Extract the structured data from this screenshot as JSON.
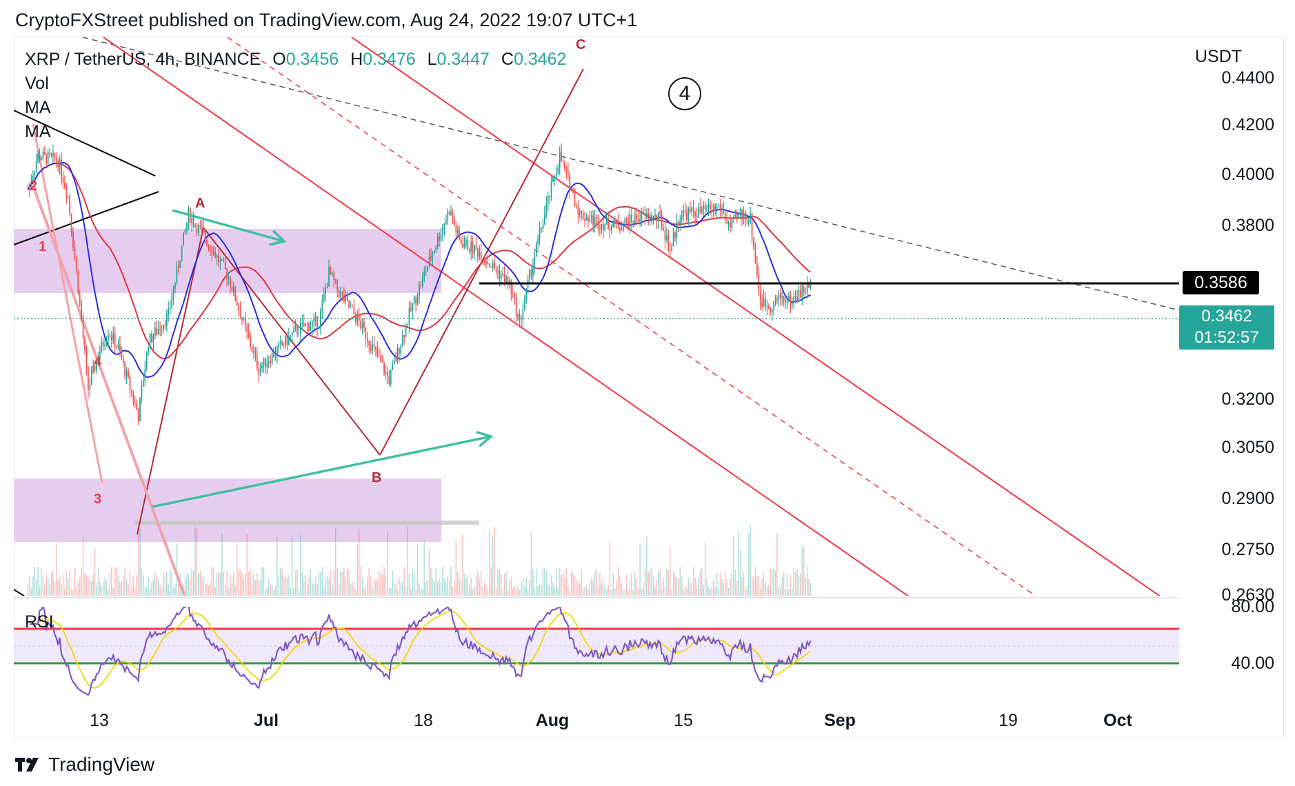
{
  "header": {
    "published": "CryptoFXStreet published on TradingView.com, Aug 24, 2022 19:07 UTC+1"
  },
  "legend": {
    "symbol": "XRP / TetherUS, 4h, BINANCE",
    "o_label": "O",
    "o_value": "0.3456",
    "h_label": "H",
    "h_value": "0.3476",
    "l_label": "L",
    "l_value": "0.3447",
    "c_label": "C",
    "c_value": "0.3462",
    "indicators": [
      "Vol",
      "MA",
      "MA"
    ]
  },
  "axis": {
    "unit": "USDT",
    "price_ticks": [
      "0.4400",
      "0.4200",
      "0.4000",
      "0.3800",
      "0.3200",
      "0.3050",
      "0.2900",
      "0.2750",
      "0.2630"
    ],
    "rsi_ticks": [
      "80.00",
      "40.00"
    ],
    "date_ticks": [
      {
        "label": "13",
        "bold": false
      },
      {
        "label": "Jul",
        "bold": true
      },
      {
        "label": "18",
        "bold": false
      },
      {
        "label": "Aug",
        "bold": true
      },
      {
        "label": "15",
        "bold": false
      },
      {
        "label": "Sep",
        "bold": true
      },
      {
        "label": "19",
        "bold": false
      },
      {
        "label": "Oct",
        "bold": true
      }
    ]
  },
  "price_tags": {
    "level": "0.3586",
    "last_price": "0.3462",
    "countdown": "01:52:57"
  },
  "annotations": {
    "wave_circle": "4",
    "labels": [
      {
        "text": "A",
        "color": "#b22833"
      },
      {
        "text": "B",
        "color": "#b22833"
      },
      {
        "text": "C",
        "color": "#b22833"
      },
      {
        "text": "1",
        "color": "#f23645"
      },
      {
        "text": "2",
        "color": "#f23645"
      },
      {
        "text": "3",
        "color": "#f23645"
      },
      {
        "text": "4",
        "color": "#f23645"
      }
    ]
  },
  "rsi": {
    "label": "RSI",
    "upper_band": 80,
    "lower_band": 40
  },
  "colors": {
    "up": "#26a69a",
    "down": "#ef5350",
    "ma_fast": "#2a2adc",
    "ma_slow": "#e0323d",
    "channel": "#f23645",
    "zone": "#e6cdf0",
    "rsi_line": "#7e57c2",
    "rsi_ma": "#f5d400"
  },
  "footer": {
    "brand": "TradingView"
  },
  "chart_data": {
    "type": "candlestick",
    "title": "XRP / TetherUS, 4h, BINANCE",
    "ylabel": "USDT",
    "last_close": 0.3462,
    "horizontal_level": 0.3586,
    "ohlc_last": {
      "open": 0.3456,
      "high": 0.3476,
      "low": 0.3447,
      "close": 0.3462
    },
    "price_path": [
      {
        "date": "2022-06-07",
        "close": 0.389
      },
      {
        "date": "2022-06-08",
        "close": 0.404
      },
      {
        "date": "2022-06-10",
        "close": 0.402
      },
      {
        "date": "2022-06-11",
        "close": 0.386
      },
      {
        "date": "2022-06-12",
        "close": 0.345
      },
      {
        "date": "2022-06-13",
        "close": 0.3
      },
      {
        "date": "2022-06-14",
        "close": 0.315
      },
      {
        "date": "2022-06-15",
        "close": 0.326
      },
      {
        "date": "2022-06-16",
        "close": 0.318
      },
      {
        "date": "2022-06-18",
        "close": 0.288
      },
      {
        "date": "2022-06-19",
        "close": 0.321
      },
      {
        "date": "2022-06-21",
        "close": 0.333
      },
      {
        "date": "2022-06-23",
        "close": 0.378
      },
      {
        "date": "2022-06-25",
        "close": 0.365
      },
      {
        "date": "2022-06-27",
        "close": 0.35
      },
      {
        "date": "2022-06-29",
        "close": 0.322
      },
      {
        "date": "2022-06-30",
        "close": 0.309
      },
      {
        "date": "2022-07-02",
        "close": 0.318
      },
      {
        "date": "2022-07-04",
        "close": 0.327
      },
      {
        "date": "2022-07-06",
        "close": 0.33
      },
      {
        "date": "2022-07-07",
        "close": 0.352
      },
      {
        "date": "2022-07-08",
        "close": 0.343
      },
      {
        "date": "2022-07-10",
        "close": 0.33
      },
      {
        "date": "2022-07-12",
        "close": 0.313
      },
      {
        "date": "2022-07-13",
        "close": 0.304
      },
      {
        "date": "2022-07-15",
        "close": 0.333
      },
      {
        "date": "2022-07-17",
        "close": 0.357
      },
      {
        "date": "2022-07-19",
        "close": 0.38
      },
      {
        "date": "2022-07-20",
        "close": 0.366
      },
      {
        "date": "2022-07-22",
        "close": 0.361
      },
      {
        "date": "2022-07-23",
        "close": 0.356
      },
      {
        "date": "2022-07-25",
        "close": 0.347
      },
      {
        "date": "2022-07-26",
        "close": 0.329
      },
      {
        "date": "2022-07-27",
        "close": 0.35
      },
      {
        "date": "2022-07-28",
        "close": 0.369
      },
      {
        "date": "2022-07-30",
        "close": 0.404
      },
      {
        "date": "2022-07-31",
        "close": 0.391
      },
      {
        "date": "2022-08-01",
        "close": 0.378
      },
      {
        "date": "2022-08-03",
        "close": 0.374
      },
      {
        "date": "2022-08-05",
        "close": 0.373
      },
      {
        "date": "2022-08-07",
        "close": 0.377
      },
      {
        "date": "2022-08-09",
        "close": 0.376
      },
      {
        "date": "2022-08-10",
        "close": 0.362
      },
      {
        "date": "2022-08-11",
        "close": 0.378
      },
      {
        "date": "2022-08-13",
        "close": 0.379
      },
      {
        "date": "2022-08-15",
        "close": 0.381
      },
      {
        "date": "2022-08-16",
        "close": 0.372
      },
      {
        "date": "2022-08-17",
        "close": 0.378
      },
      {
        "date": "2022-08-18",
        "close": 0.376
      },
      {
        "date": "2022-08-19",
        "close": 0.339
      },
      {
        "date": "2022-08-20",
        "close": 0.337
      },
      {
        "date": "2022-08-21",
        "close": 0.341
      },
      {
        "date": "2022-08-22",
        "close": 0.339
      },
      {
        "date": "2022-08-23",
        "close": 0.343
      },
      {
        "date": "2022-08-24",
        "close": 0.3462
      }
    ]
  }
}
